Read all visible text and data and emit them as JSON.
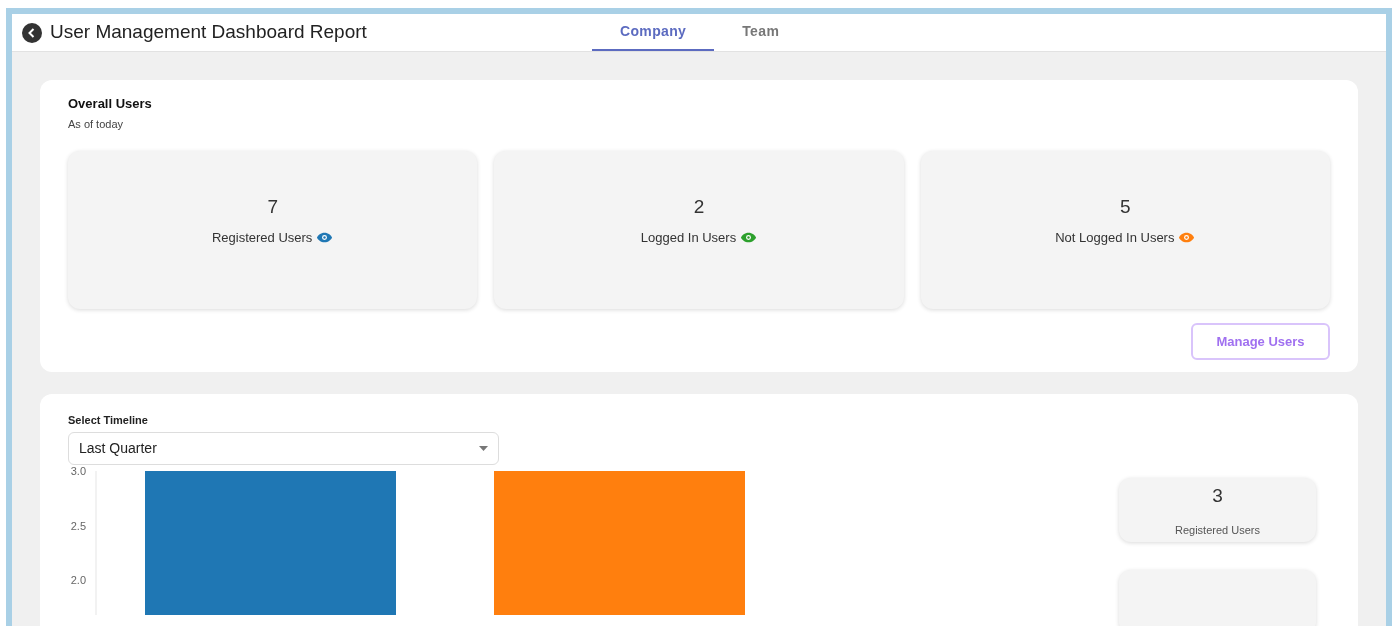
{
  "header": {
    "title": "User Management Dashboard Report"
  },
  "tabs": [
    {
      "label": "Company",
      "selected": true
    },
    {
      "label": "Team",
      "selected": false
    }
  ],
  "overall": {
    "title": "Overall Users",
    "subtitle": "As of today",
    "stats": [
      {
        "value": "7",
        "label": "Registered Users",
        "color": "#1f77b4"
      },
      {
        "value": "2",
        "label": "Logged In Users",
        "color": "#2ca02c"
      },
      {
        "value": "5",
        "label": "Not Logged In Users",
        "color": "#ff7f0e"
      }
    ],
    "button": "Manage Users"
  },
  "timeline": {
    "label": "Select Timeline",
    "value": "Last Quarter",
    "chart_data": {
      "type": "bar",
      "ylim": [
        1.65,
        3.0
      ],
      "yticks": [
        {
          "value": 3.0,
          "label": "3.0"
        },
        {
          "value": 2.5,
          "label": "2.5"
        },
        {
          "value": 2.0,
          "label": "2.0"
        }
      ],
      "categories": [
        null,
        null
      ],
      "series": [
        {
          "values": [
            3,
            3
          ],
          "colors": [
            "#1f77b4",
            "#ff7f0e"
          ]
        }
      ]
    },
    "side_stats": [
      {
        "value": "3",
        "label": "Registered Users"
      }
    ]
  }
}
